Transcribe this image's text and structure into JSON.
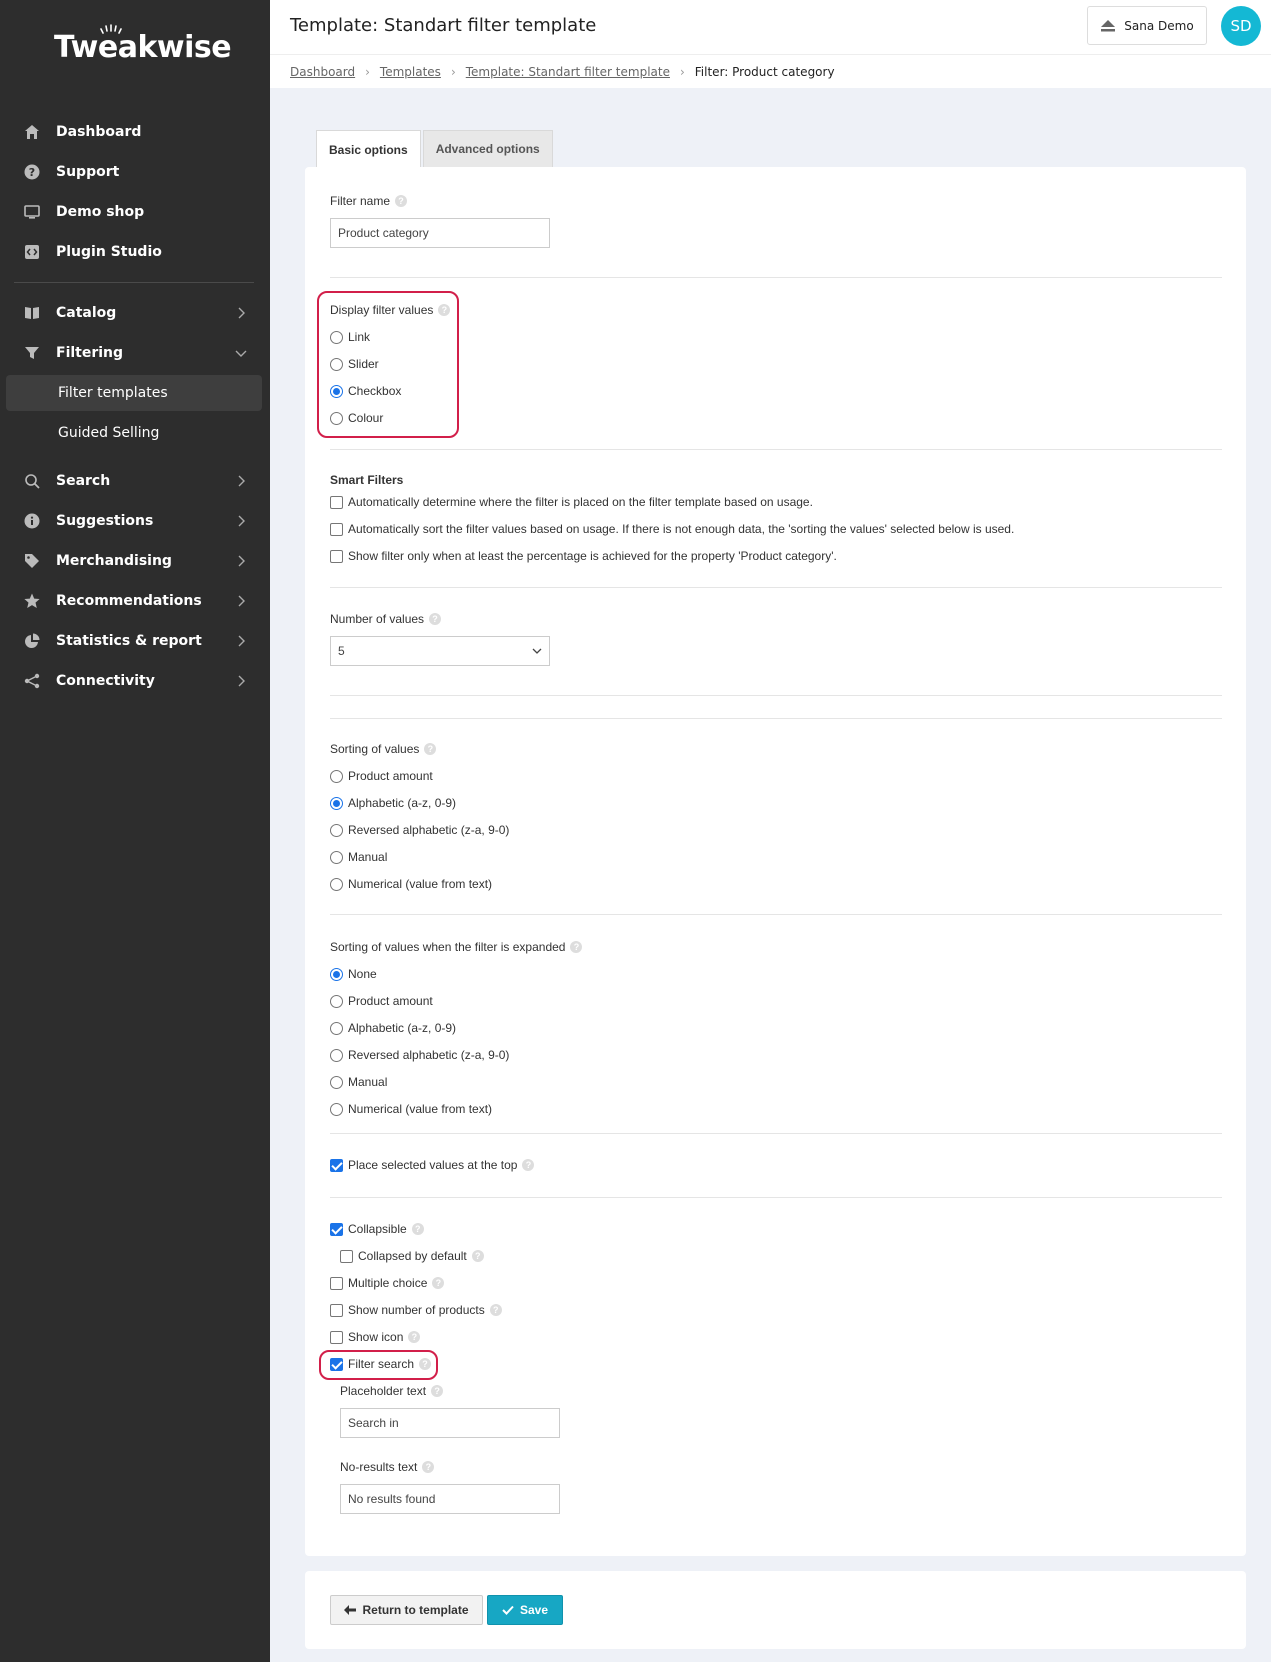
{
  "app": {
    "logo": "Tweakwise"
  },
  "sidebar": {
    "items": [
      {
        "label": "Dashboard",
        "icon": "home-icon"
      },
      {
        "label": "Support",
        "icon": "question-icon"
      },
      {
        "label": "Demo shop",
        "icon": "monitor-icon"
      },
      {
        "label": "Plugin Studio",
        "icon": "code-icon"
      },
      {
        "label": "Catalog",
        "icon": "book-icon"
      },
      {
        "label": "Filtering",
        "icon": "funnel-icon"
      },
      {
        "label": "Filter templates"
      },
      {
        "label": "Guided Selling"
      },
      {
        "label": "Search",
        "icon": "search-icon"
      },
      {
        "label": "Suggestions",
        "icon": "info-icon"
      },
      {
        "label": "Merchandising",
        "icon": "tag-icon"
      },
      {
        "label": "Recommendations",
        "icon": "star-icon"
      },
      {
        "label": "Statistics & report",
        "icon": "pie-chart-icon"
      },
      {
        "label": "Connectivity",
        "icon": "share-icon"
      }
    ]
  },
  "header": {
    "title": "Template: Standart filter template",
    "user_button": "Sana Demo",
    "avatar": "SD"
  },
  "breadcrumb": [
    "Dashboard",
    "Templates",
    "Template: Standart filter template",
    "Filter: Product category"
  ],
  "tabs": [
    "Basic options",
    "Advanced options"
  ],
  "form": {
    "filter_name_label": "Filter name",
    "filter_name_value": "Product category",
    "display_label": "Display filter values",
    "display_options": [
      "Link",
      "Slider",
      "Checkbox",
      "Colour"
    ],
    "display_selected": "Checkbox",
    "smart_title": "Smart Filters",
    "smart_options": [
      "Automatically determine where the filter is placed on the filter template based on usage.",
      "Automatically sort the filter values based on usage. If there is not enough data, the 'sorting the values' selected below is used.",
      "Show filter only when at least the percentage is achieved for the property 'Product category'."
    ],
    "num_values_label": "Number of values",
    "num_values_selected": "5",
    "sorting_label": "Sorting of values",
    "sorting_options": [
      "Product amount",
      "Alphabetic (a-z, 0-9)",
      "Reversed alphabetic (z-a, 9-0)",
      "Manual",
      "Numerical (value from text)"
    ],
    "sorting_selected": "Alphabetic (a-z, 0-9)",
    "sorting_expanded_label": "Sorting of values when the filter is expanded",
    "sorting_expanded_options": [
      "None",
      "Product amount",
      "Alphabetic (a-z, 0-9)",
      "Reversed alphabetic (z-a, 9-0)",
      "Manual",
      "Numerical (value from text)"
    ],
    "sorting_expanded_selected": "None",
    "place_selected_top": "Place selected values at the top",
    "collapsible": "Collapsible",
    "collapsed_default": "Collapsed by default",
    "multiple_choice": "Multiple choice",
    "show_number": "Show number of products",
    "show_icon": "Show icon",
    "filter_search": "Filter search",
    "placeholder_label": "Placeholder text",
    "placeholder_value": "Search in",
    "noresults_label": "No-results text",
    "noresults_value": "No results found"
  },
  "actions": {
    "return": "Return to template",
    "save": "Save"
  },
  "colors": {
    "sidebar": "#2d2d2d",
    "accent": "#17a7c4",
    "highlight": "#d21f4a",
    "radio": "#1a73e8"
  }
}
